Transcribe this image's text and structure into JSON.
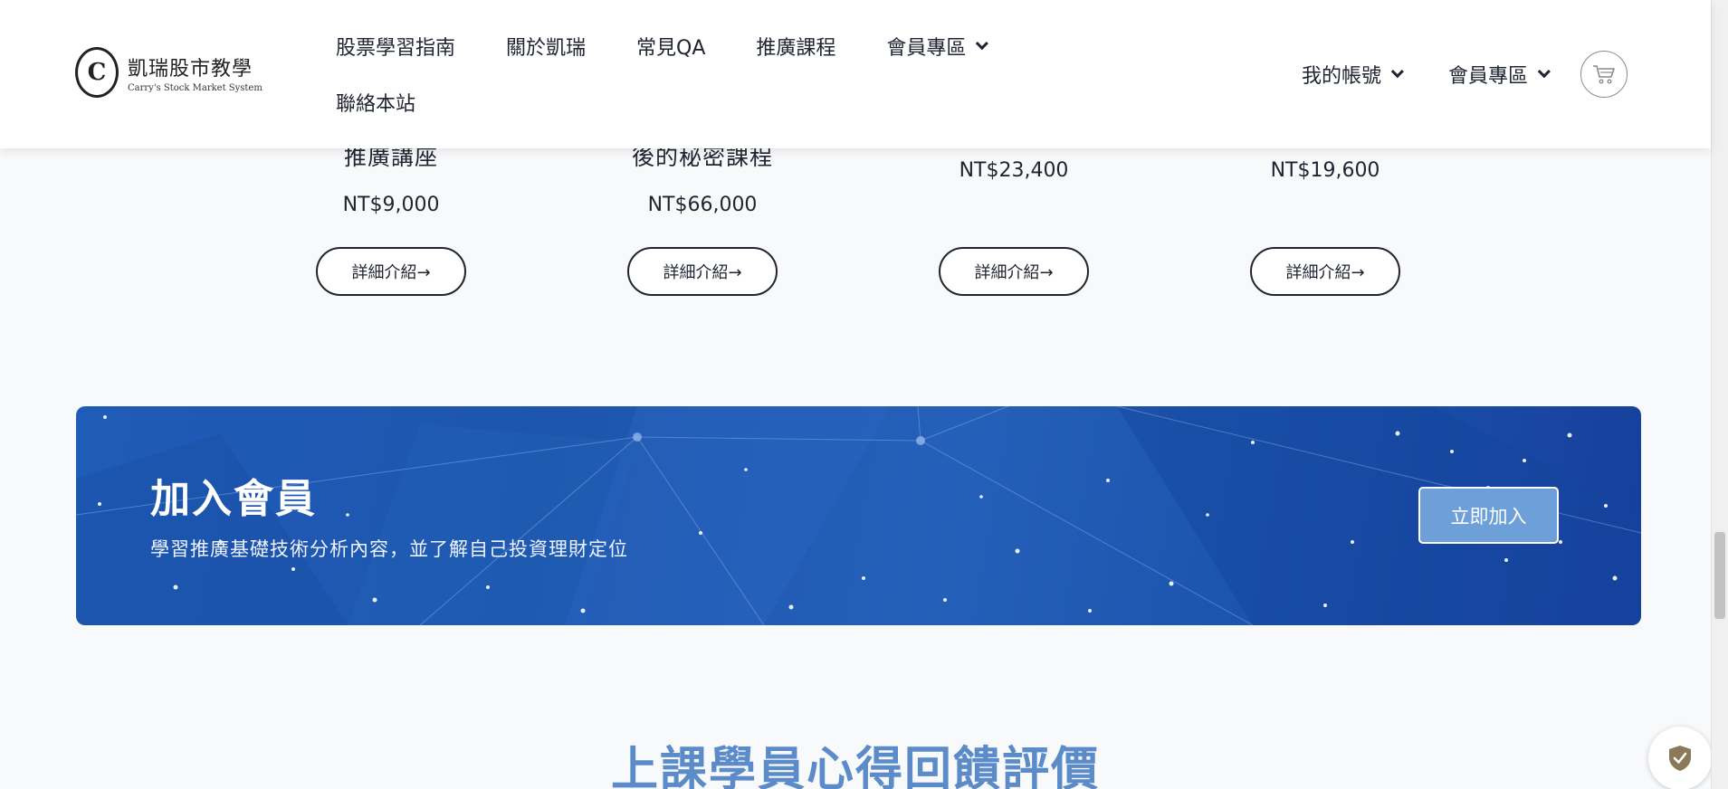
{
  "header": {
    "logo": {
      "name_cn": "凱瑞股市教學",
      "name_en": "Carry's Stock Market System"
    },
    "nav": [
      {
        "label": "股票學習指南"
      },
      {
        "label": "關於凱瑞"
      },
      {
        "label": "常見QA"
      },
      {
        "label": "推廣課程"
      },
      {
        "label": "會員專區"
      },
      {
        "label": "聯絡本站"
      }
    ],
    "account_label": "我的帳號",
    "member_label": "會員專區",
    "cart_icon": "cart-icon"
  },
  "products": [
    {
      "name": "推廣講座",
      "price": "NT$9,000",
      "button": "詳細介紹→"
    },
    {
      "name": "後的秘密課程",
      "price": "NT$66,000",
      "button": "詳細介紹→"
    },
    {
      "name": "",
      "price": "NT$23,400",
      "button": "詳細介紹→"
    },
    {
      "name": "",
      "price": "NT$19,600",
      "button": "詳細介紹→"
    }
  ],
  "banner": {
    "title": "加入會員",
    "subtitle": "學習推廣基礎技術分析內容，並了解自己投資理財定位",
    "button": "立即加入"
  },
  "testimonials": {
    "title": "上課學員心得回饋評價"
  },
  "colors": {
    "banner": "#1f5cb8",
    "join_button": "#6d9fd9",
    "section_title": "#5b8bc9"
  }
}
